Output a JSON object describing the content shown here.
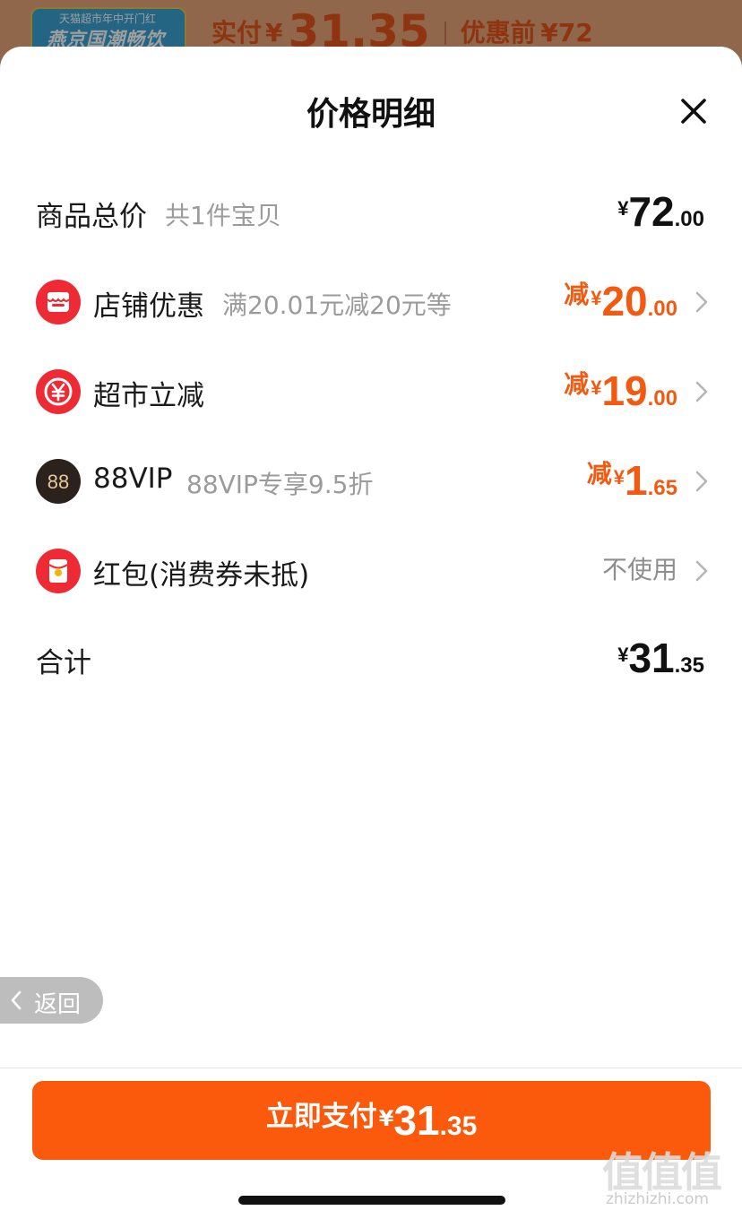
{
  "background_page": {
    "banner_small": "天猫超市年中开门红",
    "banner_big": "燕京国潮畅饮",
    "paid_label": "实付",
    "paid_yen": "¥",
    "paid_amount": "31.35",
    "pre_discount_label": "优惠前",
    "pre_discount_price": "¥72"
  },
  "sheet": {
    "title": "价格明细",
    "close_icon": "close-icon"
  },
  "rows": {
    "total_goods": {
      "label": "商品总价",
      "sub": "共1件宝贝",
      "yen": "¥",
      "int": "72",
      "dec": ".00"
    },
    "shop_discount": {
      "icon": "shop-icon",
      "label": "店铺优惠",
      "sub": "满20.01元减20元等",
      "prefix": "减",
      "yen": "¥",
      "int": "20",
      "dec": ".00"
    },
    "market_discount": {
      "icon": "yuan-coin-icon",
      "label": "超市立减",
      "prefix": "减",
      "yen": "¥",
      "int": "19",
      "dec": ".00"
    },
    "vip": {
      "icon": "88vip-icon",
      "icon_text": "88",
      "label": "88VIP",
      "sub": "88VIP专享9.5折",
      "prefix": "减",
      "yen": "¥",
      "int": "1",
      "dec": ".65"
    },
    "red_packet": {
      "icon": "red-packet-icon",
      "label": "红包(消费券未抵)",
      "value": "不使用"
    },
    "sum": {
      "label": "合计",
      "yen": "¥",
      "int": "31",
      "dec": ".35"
    }
  },
  "back_button": {
    "label": "返回"
  },
  "pay_button": {
    "label": "立即支付",
    "yen": "¥",
    "int": "31",
    "dec": ".35"
  },
  "watermark": {
    "glyphs": "值值值",
    "url": "zhizhizhi.com"
  },
  "colors": {
    "accent_orange": "#f25a12",
    "pay_button": "#fb5a0c",
    "icon_red": "#ee2a35",
    "vip_dark": "#2b211d",
    "vip_gold": "#e8c79a"
  }
}
